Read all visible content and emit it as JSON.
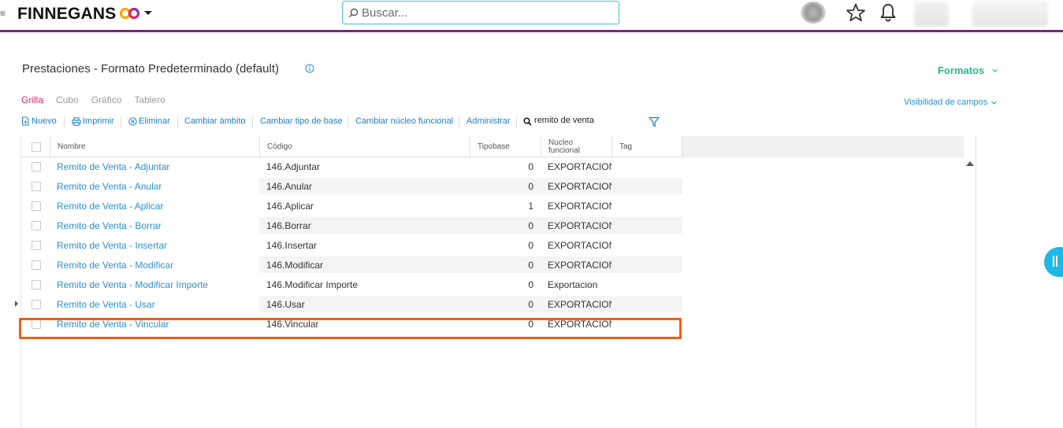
{
  "header": {
    "menu_glyph": "≡",
    "brand": "FINNEGANS",
    "brand_colors": [
      "#f2a900",
      "#e0236b",
      "#7b3fbf"
    ],
    "search_placeholder": "Buscar...",
    "icons": [
      "search-icon",
      "avatar-icon",
      "star-icon",
      "bell-icon",
      "chevron-down-icon"
    ]
  },
  "page": {
    "title": "Prestaciones - Formato Predeterminado (default)",
    "formatos_label": "Formatos",
    "visibilidad_label": "Visibilidad de campos"
  },
  "tabs": [
    {
      "label": "Grilla",
      "active": true
    },
    {
      "label": "Cubo",
      "active": false
    },
    {
      "label": "Gráfico",
      "active": false
    },
    {
      "label": "Tablero",
      "active": false
    }
  ],
  "toolbar": {
    "nuevo": "Nuevo",
    "imprimir": "Imprimir",
    "eliminar": "Eliminar",
    "cambiar_ambito": "Cambiar ámbito",
    "cambiar_tipo_base": "Cambiar tipo de base",
    "cambiar_nucleo": "Cambiar núcleo funcional",
    "administrar": "Administrar",
    "filter_value": "remito de venta"
  },
  "grid": {
    "columns": {
      "nombre": "Nombre",
      "codigo": "Código",
      "tipobase": "Tipobase",
      "nucleo_1": "Nucleo",
      "nucleo_2": "funcional",
      "tag": "Tag"
    },
    "rows": [
      {
        "nombre": "Remito de Venta - Adjuntar",
        "codigo": "146.Adjuntar",
        "tipobase": "0",
        "nucleo": "EXPORTACION"
      },
      {
        "nombre": "Remito de Venta - Anular",
        "codigo": "146.Anular",
        "tipobase": "0",
        "nucleo": "EXPORTACION"
      },
      {
        "nombre": "Remito de Venta - Aplicar",
        "codigo": "146.Aplicar",
        "tipobase": "1",
        "nucleo": "EXPORTACION"
      },
      {
        "nombre": "Remito de Venta - Borrar",
        "codigo": "146.Borrar",
        "tipobase": "0",
        "nucleo": "EXPORTACION"
      },
      {
        "nombre": "Remito de Venta - Insertar",
        "codigo": "146.Insertar",
        "tipobase": "0",
        "nucleo": "EXPORTACION"
      },
      {
        "nombre": "Remito de Venta - Modificar",
        "codigo": "146.Modificar",
        "tipobase": "0",
        "nucleo": "EXPORTACION"
      },
      {
        "nombre": "Remito de Venta - Modificar Importe",
        "codigo": "146.Modificar Importe",
        "tipobase": "0",
        "nucleo": "Exportacion"
      },
      {
        "nombre": "Remito de Venta - Usar",
        "codigo": "146.Usar",
        "tipobase": "0",
        "nucleo": "EXPORTACION"
      },
      {
        "nombre": "Remito de Venta - Vincular",
        "codigo": "146.Vincular",
        "tipobase": "0",
        "nucleo": "EXPORTACION"
      }
    ]
  },
  "accent_colors": {
    "header_line": "#6e2d73",
    "link": "#2a8fd4",
    "active_tab": "#e0236b",
    "formatos": "#1bbf8f",
    "highlight": "#e8601c",
    "side_handle": "#1fb8e6"
  }
}
